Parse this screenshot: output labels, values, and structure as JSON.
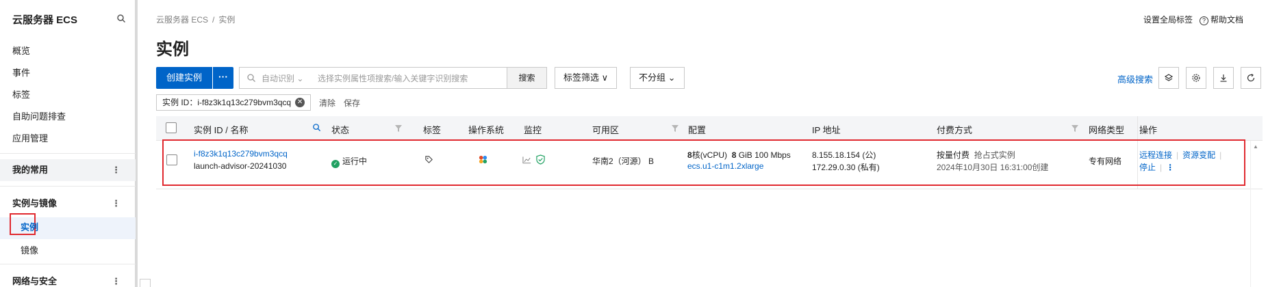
{
  "sidebar": {
    "title": "云服务器 ECS",
    "items": [
      "概览",
      "事件",
      "标签",
      "自助问题排查",
      "应用管理"
    ],
    "groups": [
      {
        "label": "我的常用",
        "more": "⋮"
      },
      {
        "label": "实例与镜像",
        "more": "⋮"
      },
      {
        "label": "网络与安全",
        "more": "⋮"
      }
    ],
    "active_item": "实例",
    "sub_items": [
      "镜像"
    ]
  },
  "breadcrumb": {
    "root": "云服务器 ECS",
    "separator": "/",
    "current": "实例"
  },
  "page_title": "实例",
  "top_right": {
    "global_tags": "设置全局标签",
    "help_docs": "帮助文档"
  },
  "toolbar": {
    "create_label": "创建实例",
    "more_label": "···",
    "search_mode": "自动识别",
    "search_placeholder": "选择实例属性项搜索/输入关键字识别搜索",
    "search_button": "搜索",
    "tag_filter": "标签筛选",
    "group_select": "不分组",
    "advanced_search": "高级搜索"
  },
  "filter": {
    "chip": "实例 ID：i-f8z3k1q13c279bvm3qcq",
    "clear": "清除",
    "save": "保存"
  },
  "table": {
    "columns": [
      "实例 ID / 名称",
      "状态",
      "标签",
      "操作系统",
      "监控",
      "可用区",
      "配置",
      "IP 地址",
      "付费方式",
      "网络类型",
      "操作"
    ],
    "row": {
      "instance_id": "i-f8z3k1q13c279bvm3qcq",
      "instance_name": "launch-advisor-20241030",
      "status": "运行中",
      "zone": "华南2（河源） B",
      "cpu_num": "8",
      "cpu_unit": "核(vCPU)",
      "mem_num": "8",
      "mem_unit": "GiB",
      "bandwidth": "100 Mbps",
      "instance_type": "ecs.u1-c1m1.2xlarge",
      "public_ip": "8.155.18.154 (公)",
      "private_ip": "172.29.0.30 (私有)",
      "billing": "按量付费",
      "billing_note": "抢占式实例",
      "created": "2024年10月30日 16:31:00创建",
      "network": "专有网络",
      "actions": [
        "远程连接",
        "资源变配",
        "停止"
      ],
      "more": "⋮"
    }
  },
  "colors": {
    "primary": "#0064c8",
    "highlight": "#e0282e",
    "running": "#20a162"
  }
}
